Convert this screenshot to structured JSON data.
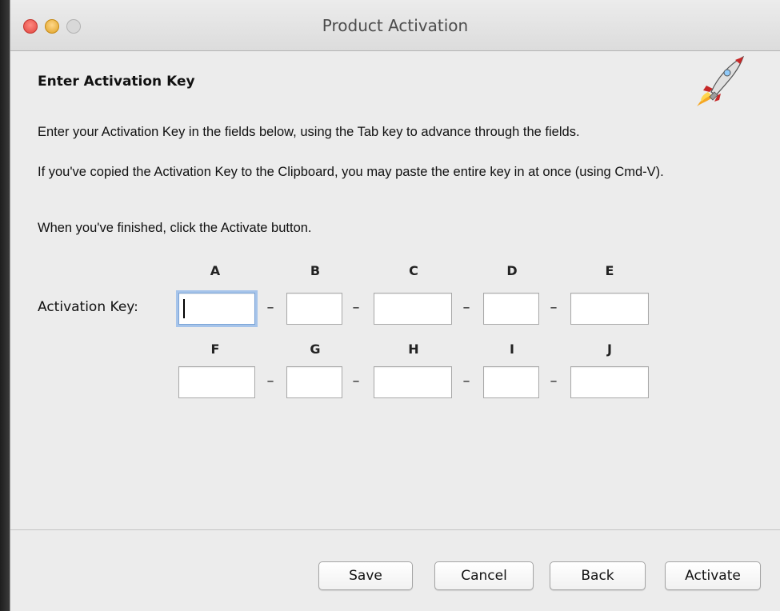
{
  "window": {
    "title": "Product Activation"
  },
  "heading": "Enter Activation Key",
  "paragraphs": [
    "Enter your Activation Key in the fields below, using the Tab key to advance through the fields.",
    "If you've copied the Activation Key to the Clipboard, you may paste the entire key in at once (using Cmd-V).",
    "When you've finished, click the Activate button."
  ],
  "activation": {
    "label": "Activation Key:",
    "separator": "–",
    "row1_columns": [
      "A",
      "B",
      "C",
      "D",
      "E"
    ],
    "row2_columns": [
      "F",
      "G",
      "H",
      "I",
      "J"
    ],
    "row1_values": [
      "",
      "",
      "",
      "",
      ""
    ],
    "row2_values": [
      "",
      "",
      "",
      "",
      ""
    ],
    "focused_field": "A"
  },
  "buttons": {
    "save": "Save",
    "cancel": "Cancel",
    "back": "Back",
    "activate": "Activate"
  },
  "icons": {
    "app_logo": "rocket-icon"
  }
}
